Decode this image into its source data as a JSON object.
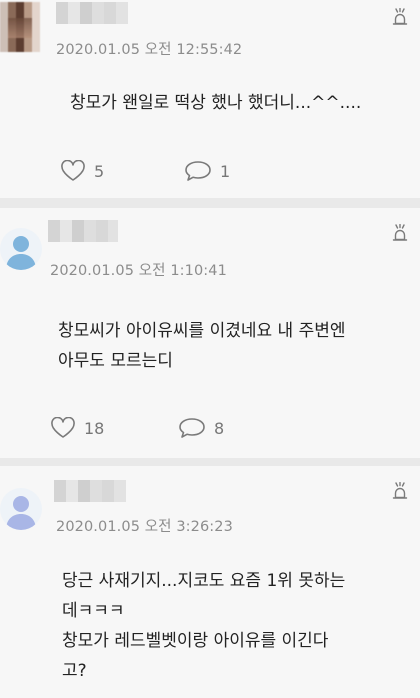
{
  "comments": [
    {
      "timestamp": "2020.01.05 오전 12:55:42",
      "text": "창모가 왠일로 떡상 했나 했더니...^^....",
      "likes": "5",
      "replies": "1"
    },
    {
      "timestamp": "2020.01.05 오전 1:10:41",
      "text": "창모씨가 아이유씨를 이겼네요 내 주변엔\n아무도 모르는디",
      "likes": "18",
      "replies": "8"
    },
    {
      "timestamp": "2020.01.05 오전 3:26:23",
      "text": "당근 사재기지...지코도 요즘 1위 못하는\n데ㅋㅋㅋ\n창모가 레드벨벳이랑 아이유를 이긴다\n고?",
      "likes": "",
      "replies": ""
    }
  ],
  "colors": {
    "page_background": "#e9e9e9",
    "card_background": "#f7f7f7",
    "timestamp": "#8c8c8c",
    "body_text": "#222222",
    "icon": "#7a7a7a",
    "avatar_blue": "#7fb4dc",
    "avatar_lavender": "#a9b6e6"
  },
  "icons": [
    "blurred-avatar-photo",
    "person-avatar-icon",
    "report-icon",
    "heart-icon",
    "comment-bubble-icon"
  ]
}
